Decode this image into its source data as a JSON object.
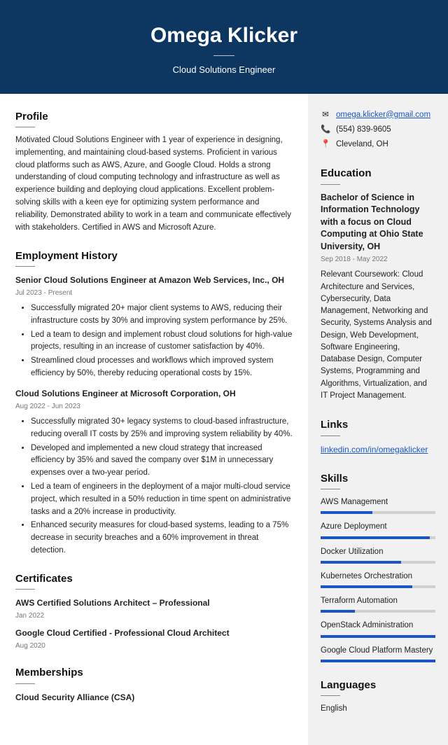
{
  "header": {
    "name": "Omega Klicker",
    "title": "Cloud Solutions Engineer"
  },
  "profile": {
    "heading": "Profile",
    "text": "Motivated Cloud Solutions Engineer with 1 year of experience in designing, implementing, and maintaining cloud-based systems. Proficient in various cloud platforms such as AWS, Azure, and Google Cloud. Holds a strong understanding of cloud computing technology and infrastructure as well as experience building and deploying cloud applications. Excellent problem-solving skills with a keen eye for optimizing system performance and reliability. Demonstrated ability to work in a team and communicate effectively with stakeholders. Certified in AWS and Microsoft Azure."
  },
  "employment": {
    "heading": "Employment History",
    "jobs": [
      {
        "title": "Senior Cloud Solutions Engineer at Amazon Web Services, Inc., OH",
        "dates": "Jul 2023 - Present",
        "bullets": [
          "Successfully migrated 20+ major client systems to AWS, reducing their infrastructure costs by 30% and improving system performance by 25%.",
          "Led a team to design and implement robust cloud solutions for high-value projects, resulting in an increase of customer satisfaction by 40%.",
          "Streamlined cloud processes and workflows which improved system efficiency by 50%, thereby reducing operational costs by 15%."
        ]
      },
      {
        "title": "Cloud Solutions Engineer at Microsoft Corporation, OH",
        "dates": "Aug 2022 - Jun 2023",
        "bullets": [
          "Successfully migrated 30+ legacy systems to cloud-based infrastructure, reducing overall IT costs by 25% and improving system reliability by 40%.",
          "Developed and implemented a new cloud strategy that increased efficiency by 35% and saved the company over $1M in unnecessary expenses over a two-year period.",
          "Led a team of engineers in the deployment of a major multi-cloud service project, which resulted in a 50% reduction in time spent on administrative tasks and a 20% increase in productivity.",
          "Enhanced security measures for cloud-based systems, leading to a 75% decrease in security breaches and a 60% improvement in threat detection."
        ]
      }
    ]
  },
  "certificates": {
    "heading": "Certificates",
    "items": [
      {
        "title": "AWS Certified Solutions Architect – Professional",
        "date": "Jan 2022"
      },
      {
        "title": "Google Cloud Certified - Professional Cloud Architect",
        "date": "Aug 2020"
      }
    ]
  },
  "memberships": {
    "heading": "Memberships",
    "items": [
      {
        "title": "Cloud Security Alliance (CSA)"
      }
    ]
  },
  "contact": {
    "email": "omega.klicker@gmail.com",
    "phone": "(554) 839-9605",
    "location": "Cleveland, OH"
  },
  "education": {
    "heading": "Education",
    "title": "Bachelor of Science in Information Technology with a focus on Cloud Computing at Ohio State University, OH",
    "dates": "Sep 2018 - May 2022",
    "text": "Relevant Coursework: Cloud Architecture and Services, Cybersecurity, Data Management, Networking and Security, Systems Analysis and Design, Web Development, Software Engineering, Database Design, Computer Systems, Programming and Algorithms, Virtualization, and IT Project Management."
  },
  "links": {
    "heading": "Links",
    "url": "linkedin.com/in/omegaklicker"
  },
  "skills": {
    "heading": "Skills",
    "items": [
      {
        "name": "AWS Management",
        "level": 45
      },
      {
        "name": "Azure Deployment",
        "level": 95
      },
      {
        "name": "Docker Utilization",
        "level": 70
      },
      {
        "name": "Kubernetes Orchestration",
        "level": 80
      },
      {
        "name": "Terraform Automation",
        "level": 30
      },
      {
        "name": "OpenStack Administration",
        "level": 100
      },
      {
        "name": "Google Cloud Platform Mastery",
        "level": 100
      }
    ]
  },
  "languages": {
    "heading": "Languages",
    "items": [
      {
        "name": "English"
      }
    ]
  }
}
